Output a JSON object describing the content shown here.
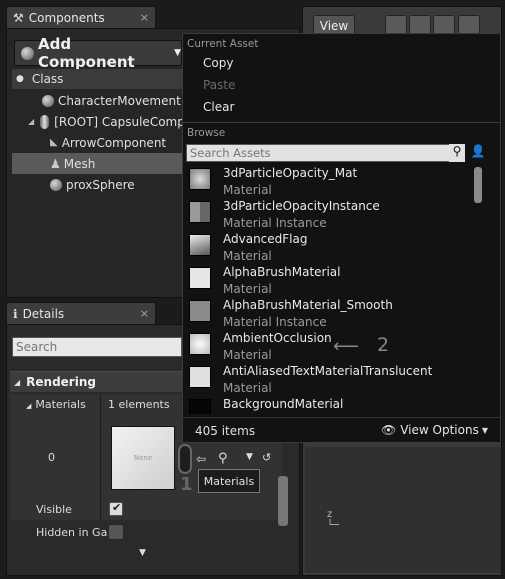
{
  "components_tab": {
    "title": "Components",
    "close": "×"
  },
  "toolbar": {
    "add_component_label": "Add Component"
  },
  "tree": {
    "items": [
      {
        "label": "Class"
      },
      {
        "label": "CharacterMovement"
      },
      {
        "label": "[ROOT] CapsuleCompo"
      },
      {
        "label": "ArrowComponent"
      },
      {
        "label": "Mesh"
      },
      {
        "label": "proxSphere"
      }
    ]
  },
  "viewport": {
    "view_button": "View"
  },
  "details_tab": {
    "title": "Details",
    "close": "×"
  },
  "details": {
    "search_placeholder": "Search",
    "section": "Rendering",
    "materials_label": "Materials",
    "materials_count": "1 elements",
    "element_index": "0",
    "thumb_text": "None",
    "tooltip": "Materials",
    "visible_label": "Visible",
    "hidden_label": "Hidden in Ga",
    "callout_1": "1"
  },
  "menu": {
    "current_asset_header": "Current Asset",
    "copy": "Copy",
    "paste": "Paste",
    "clear": "Clear",
    "browse_header": "Browse",
    "search_placeholder": "Search Assets",
    "assets": [
      {
        "name": "3dParticleOpacity_Mat",
        "type": "Material"
      },
      {
        "name": "3dParticleOpacityInstance",
        "type": "Material Instance"
      },
      {
        "name": "AdvancedFlag",
        "type": "Material"
      },
      {
        "name": "AlphaBrushMaterial",
        "type": "Material"
      },
      {
        "name": "AlphaBrushMaterial_Smooth",
        "type": "Material Instance"
      },
      {
        "name": "AmbientOcclusion",
        "type": "Material"
      },
      {
        "name": "AntiAliasedTextMaterialTranslucent",
        "type": "Material"
      },
      {
        "name": "BackgroundMaterial",
        "type": "Material"
      }
    ],
    "item_count": "405 items",
    "view_options": "View Options",
    "callout_2": "2"
  }
}
